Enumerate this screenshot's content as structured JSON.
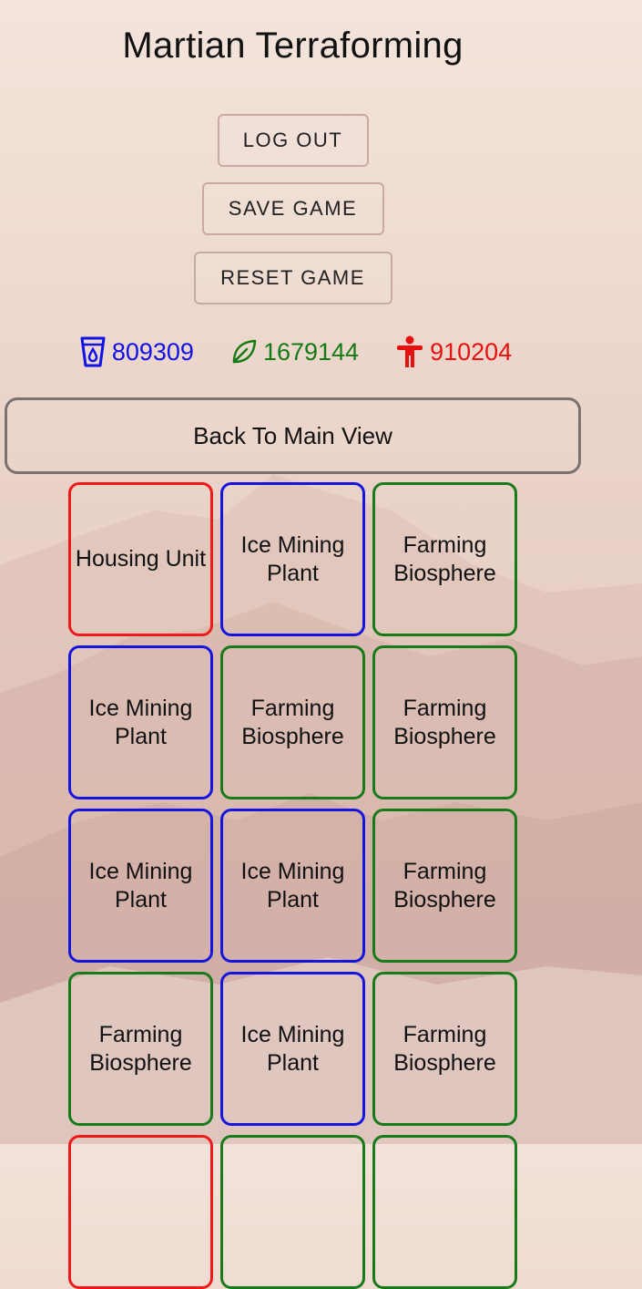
{
  "app": {
    "title": "Martian Terraforming"
  },
  "buttons": {
    "logout": "LOG OUT",
    "save": "SAVE GAME",
    "reset": "RESET GAME"
  },
  "stats": {
    "water": {
      "value": "809309",
      "icon": "water-glass-icon",
      "color": "#1010e8"
    },
    "food": {
      "value": "1679144",
      "icon": "leaf-icon",
      "color": "#147a14"
    },
    "population": {
      "value": "910204",
      "icon": "person-icon",
      "color": "#e81010"
    }
  },
  "nav": {
    "back_label": "Back To Main View"
  },
  "buildings": [
    {
      "label": "Housing Unit",
      "kind": "housing",
      "color": "red"
    },
    {
      "label": "Ice Mining Plant",
      "kind": "ice",
      "color": "blue"
    },
    {
      "label": "Farming Biosphere",
      "kind": "farm",
      "color": "green"
    },
    {
      "label": "Ice Mining Plant",
      "kind": "ice",
      "color": "blue"
    },
    {
      "label": "Farming Biosphere",
      "kind": "farm",
      "color": "green"
    },
    {
      "label": "Farming Biosphere",
      "kind": "farm",
      "color": "green"
    },
    {
      "label": "Ice Mining Plant",
      "kind": "ice",
      "color": "blue"
    },
    {
      "label": "Ice Mining Plant",
      "kind": "ice",
      "color": "blue"
    },
    {
      "label": "Farming Biosphere",
      "kind": "farm",
      "color": "green"
    },
    {
      "label": "Farming Biosphere",
      "kind": "farm",
      "color": "green"
    },
    {
      "label": "Ice Mining Plant",
      "kind": "ice",
      "color": "blue"
    },
    {
      "label": "Farming Biosphere",
      "kind": "farm",
      "color": "green"
    },
    {
      "label": "",
      "kind": "housing",
      "color": "red"
    },
    {
      "label": "",
      "kind": "farm",
      "color": "green"
    },
    {
      "label": "",
      "kind": "farm",
      "color": "green"
    }
  ],
  "colors": {
    "housing": "#ee1a1a",
    "ice": "#1515dd",
    "farm": "#187a18"
  }
}
